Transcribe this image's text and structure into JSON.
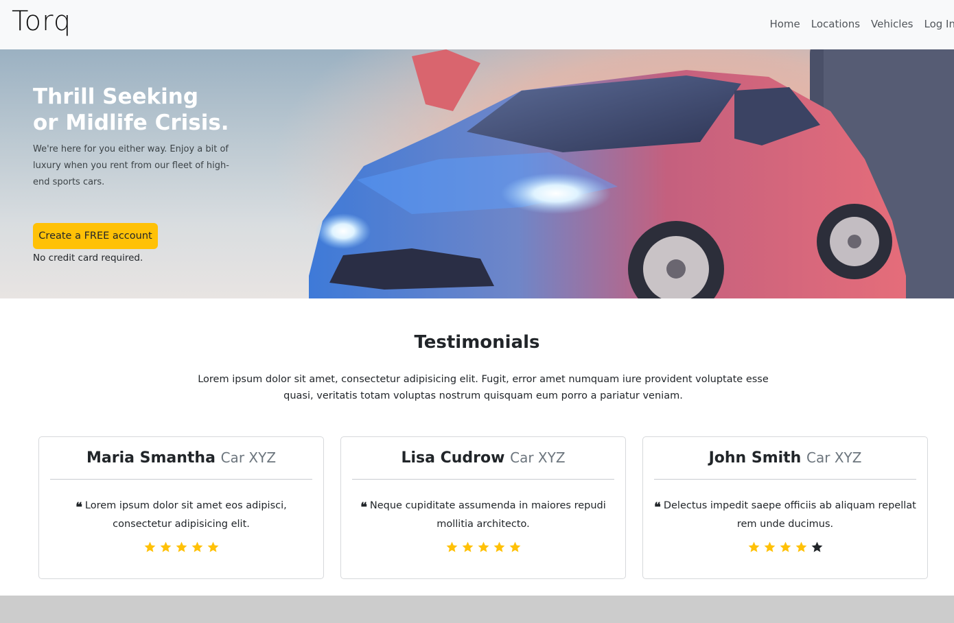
{
  "brand": {
    "name": "Torq"
  },
  "nav": {
    "items": [
      {
        "label": "Home"
      },
      {
        "label": "Locations"
      },
      {
        "label": "Vehicles"
      },
      {
        "label": "Log In"
      }
    ]
  },
  "hero": {
    "title_line1": "Thrill Seeking",
    "title_line2": "or Midlife Crisis.",
    "description": "We're here for you either way. Enjoy a bit of luxury when you rent from our fleet of high-end sports cars.",
    "cta_label": "Create a FREE account",
    "note": "No credit card required."
  },
  "testimonials": {
    "title": "Testimonials",
    "intro": "Lorem ipsum dolor sit amet, consectetur adipisicing elit. Fugit, error amet numquam iure provident voluptate esse quasi, veritatis totam voluptas nostrum quisquam eum porro a pariatur veniam.",
    "cards": [
      {
        "name": "Maria Smantha",
        "car": "Car XYZ",
        "quote": "Lorem ipsum dolor sit amet eos adipisci, consectetur adipisicing elit.",
        "rating": 5
      },
      {
        "name": "Lisa Cudrow",
        "car": "Car XYZ",
        "quote": "Neque cupiditate assumenda in maiores repudi mollitia architecto.",
        "rating": 5
      },
      {
        "name": "John Smith",
        "car": "Car XYZ",
        "quote": "Delectus impedit saepe officiis ab aliquam repellat rem unde ducimus.",
        "rating": 4
      }
    ]
  },
  "colors": {
    "accent": "#ffc107",
    "star_filled": "#ffc107",
    "star_empty": "#212529",
    "navbar_bg": "#f8f9fa",
    "footer_bg": "#cccccc"
  }
}
